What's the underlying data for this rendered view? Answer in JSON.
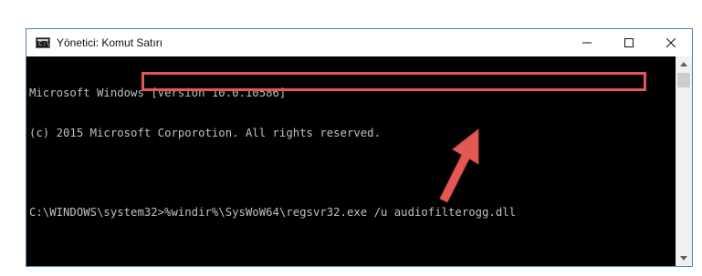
{
  "window": {
    "title": "Yönetici: Komut Satırı",
    "app_icon": "cmd-icon",
    "app_icon_glyph": "C:\\",
    "controls": [
      "minimize-icon",
      "maximize-icon",
      "close-icon"
    ]
  },
  "console": {
    "lines": [
      "Microsoft Windows [Version 10.0.10586]",
      "(c) 2015 Microsoft Corporotion. All rights reserved.",
      "",
      "C:\\WINDOWS\\system32>%windir%\\SysWoW64\\regsvr32.exe /u audiofilterogg.dll"
    ]
  },
  "annotation": {
    "highlight_color": "#e35755",
    "arrow_color": "#e35755"
  }
}
